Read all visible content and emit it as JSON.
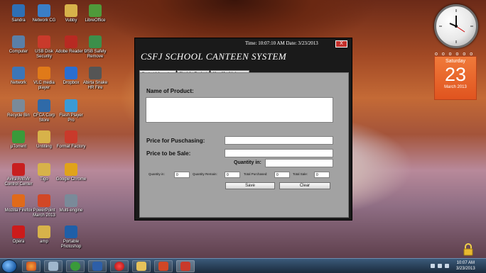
{
  "desktop_icons": [
    {
      "label": "Sandra",
      "color": "#2e6fb5"
    },
    {
      "label": "Network CG",
      "color": "#3a7ec7"
    },
    {
      "label": "Vubby",
      "color": "#d7b24a"
    },
    {
      "label": "LibreOffice",
      "color": "#4f9a3a"
    },
    {
      "label": "Computer",
      "color": "#5a7fa8"
    },
    {
      "label": "USB Disk Security",
      "color": "#c93a2b"
    },
    {
      "label": "Adobe Reader 9",
      "color": "#b82a22"
    },
    {
      "label": "USB Safely Remove",
      "color": "#3c8f4a"
    },
    {
      "label": "Network",
      "color": "#3b76b8"
    },
    {
      "label": "VLC media player",
      "color": "#e07a19"
    },
    {
      "label": "Dropbox",
      "color": "#2a6ed1"
    },
    {
      "label": "Abirta Snake HR Fire",
      "color": "#555555"
    },
    {
      "label": "Recycle Bin",
      "color": "#7a8a99"
    },
    {
      "label": "CFCA Corp Store",
      "color": "#2f6aa8"
    },
    {
      "label": "Flash Player Pro",
      "color": "#3a9ad6"
    },
    {
      "label": "µTorrent",
      "color": "#3a9a3a"
    },
    {
      "label": "Untitling",
      "color": "#d7b24a"
    },
    {
      "label": "Format Factory",
      "color": "#c93a2b"
    },
    {
      "label": "Avira AntiVir Control Center",
      "color": "#c81f1f"
    },
    {
      "label": "Tigo",
      "color": "#d7b24a"
    },
    {
      "label": "Google Chrome",
      "color": "#e0a31a"
    },
    {
      "label": "Mozilla Firefox",
      "color": "#e06a1a"
    },
    {
      "label": "PowerPoint March 2013",
      "color": "#d24726"
    },
    {
      "label": "Multi-engine",
      "color": "#7a8a99"
    },
    {
      "label": "Opera",
      "color": "#cc1b1b"
    },
    {
      "label": "amp",
      "color": "#d7b24a"
    },
    {
      "label": "Portable Photoshop",
      "color": "#1f5fa8"
    }
  ],
  "calendar": {
    "day": "Saturday",
    "date": "23",
    "month": "March 2013"
  },
  "app": {
    "title": "CSFJ SCHOOL CANTEEN SYSTEM",
    "time_text": "Time: 10:07:10 AM Date: 3/23/2013",
    "close_label": "X",
    "tabs": [
      "Product Information",
      "Stock for Product",
      "View Monthly Income"
    ],
    "fields": {
      "name_label": "Name of Product:",
      "price_purchase_label": "Price for Puschasing:",
      "price_sale_label": "Price to be Sale:",
      "quantity_in_label": "Quantity in:",
      "qty_in_small_label": "Quantity in:",
      "qty_in_value": "0",
      "qty_remain_label": "Quantity Remain:",
      "qty_remain_value": "0",
      "total_purchase_label": "Total Purchased:",
      "total_purchase_value": "0",
      "total_sale_label": "Total Sale:",
      "total_sale_value": "0"
    },
    "buttons": {
      "save": "Save",
      "clear": "Clear"
    }
  },
  "taskbar": {
    "time": "10:07 AM",
    "date": "3/23/2013"
  }
}
